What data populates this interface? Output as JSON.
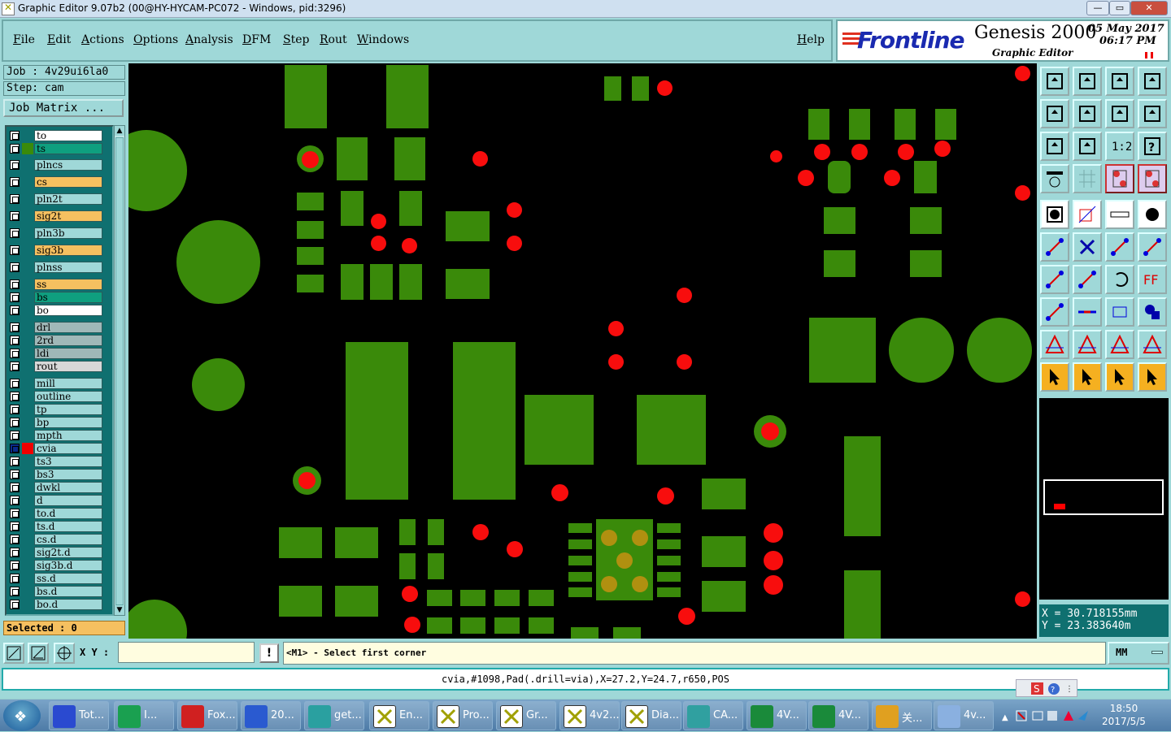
{
  "window": {
    "title": "Graphic Editor 9.07b2 (00@HY-HYCAM-PC072 - Windows, pid:3296)"
  },
  "menu": {
    "items": [
      "File",
      "Edit",
      "Actions",
      "Options",
      "Analysis",
      "DFM",
      "Step",
      "Rout",
      "Windows"
    ],
    "help": "Help"
  },
  "brand": {
    "logo_text": "Frontline",
    "product": "Genesis 2000",
    "subtitle": "Graphic Editor",
    "date": "05 May 2017",
    "time": "06:17 PM"
  },
  "job": {
    "job_label": "Job : 4v29ui6la0",
    "step_label": "Step: cam",
    "matrix_button": "Job Matrix ..."
  },
  "layers": [
    {
      "name": "to",
      "color": "#ffffff"
    },
    {
      "name": "ts",
      "color": "#0f9f7f",
      "swatch": "#3a8a0a"
    },
    {
      "name": "plncs",
      "color": "#9fd8d8"
    },
    {
      "name": "cs",
      "color": "#f5c060"
    },
    {
      "name": "pln2t",
      "color": "#9fd8d8"
    },
    {
      "name": "sig2t",
      "color": "#f5c060"
    },
    {
      "name": "pln3b",
      "color": "#9fd8d8"
    },
    {
      "name": "sig3b",
      "color": "#f5c060"
    },
    {
      "name": "plnss",
      "color": "#9fd8d8"
    },
    {
      "name": "ss",
      "color": "#f5c060"
    },
    {
      "name": "bs",
      "color": "#0f9f7f"
    },
    {
      "name": "bo",
      "color": "#ffffff"
    },
    {
      "name": "drl",
      "color": "#9fb8b8"
    },
    {
      "name": "2rd",
      "color": "#9fb8b8"
    },
    {
      "name": "ldi",
      "color": "#9fb8b8"
    },
    {
      "name": "rout",
      "color": "#d8d8d8"
    },
    {
      "name": "mill",
      "color": "#9fd8d8"
    },
    {
      "name": "outline",
      "color": "#9fd8d8"
    },
    {
      "name": "tp",
      "color": "#9fd8d8"
    },
    {
      "name": "bp",
      "color": "#9fd8d8"
    },
    {
      "name": "mpth",
      "color": "#9fd8d8"
    },
    {
      "name": "cvia",
      "color": "#9fd8d8",
      "swatch": "#f00000",
      "active": true
    },
    {
      "name": "ts3",
      "color": "#9fd8d8"
    },
    {
      "name": "bs3",
      "color": "#9fd8d8"
    },
    {
      "name": "dwkl",
      "color": "#9fd8d8"
    },
    {
      "name": "d",
      "color": "#9fd8d8"
    },
    {
      "name": "to.d",
      "color": "#9fd8d8"
    },
    {
      "name": "ts.d",
      "color": "#9fd8d8"
    },
    {
      "name": "cs.d",
      "color": "#9fd8d8"
    },
    {
      "name": "sig2t.d",
      "color": "#9fd8d8"
    },
    {
      "name": "sig3b.d",
      "color": "#9fd8d8"
    },
    {
      "name": "ss.d",
      "color": "#9fd8d8"
    },
    {
      "name": "bs.d",
      "color": "#9fd8d8"
    },
    {
      "name": "bo.d",
      "color": "#9fd8d8"
    }
  ],
  "selected": "Selected : 0",
  "coords": {
    "x": "X = 30.718155mm",
    "y": "Y = 23.383640m"
  },
  "command": {
    "xy_label": "X Y :",
    "xy_value": "",
    "prompt": "<M1> - Select first corner",
    "units": "MM",
    "exclaim": "!"
  },
  "status_line": "cvia,#1098,Pad(.drill=via),X=27.2,Y=24.7,r650,POS",
  "colors": {
    "copper": "#3a8a0a",
    "via": "#f80d0d",
    "background": "#000000",
    "panel": "#9fd8d8"
  },
  "taskbar": {
    "items": [
      {
        "label": "Tot...",
        "icon": "floppy-icon"
      },
      {
        "label": "I...",
        "icon": "app-f-icon"
      },
      {
        "label": "Fox...",
        "icon": "foxit-icon"
      },
      {
        "label": "20...",
        "icon": "word-icon"
      },
      {
        "label": "get...",
        "icon": "disc-icon"
      },
      {
        "label": "En...",
        "icon": "genesis-icon"
      },
      {
        "label": "Pro...",
        "icon": "genesis-icon"
      },
      {
        "label": "Gr...",
        "icon": "genesis-icon"
      },
      {
        "label": "4v2...",
        "icon": "genesis-icon"
      },
      {
        "label": "Dia...",
        "icon": "genesis-icon"
      },
      {
        "label": "CA...",
        "icon": "cam-icon"
      },
      {
        "label": "4V...",
        "icon": "excel-icon"
      },
      {
        "label": "4V...",
        "icon": "excel-icon"
      },
      {
        "label": "关...",
        "icon": "shell-icon"
      },
      {
        "label": "4v...",
        "icon": "notepad-icon"
      }
    ],
    "clock_time": "18:50",
    "clock_date": "2017/5/5"
  }
}
